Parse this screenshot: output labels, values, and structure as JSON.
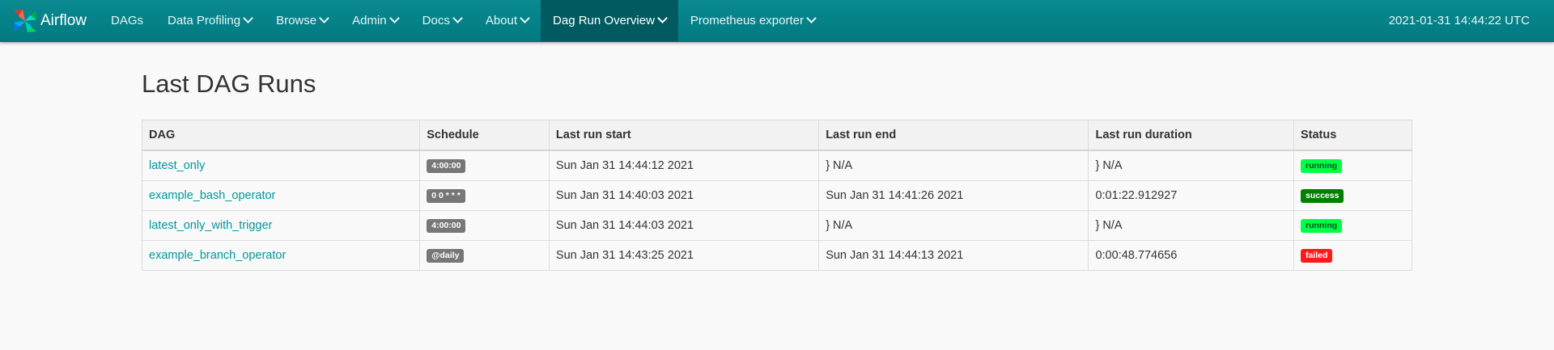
{
  "brand": {
    "name": "Airflow"
  },
  "nav": [
    {
      "label": "DAGs",
      "dropdown": false,
      "active": false
    },
    {
      "label": "Data Profiling",
      "dropdown": true,
      "active": false
    },
    {
      "label": "Browse",
      "dropdown": true,
      "active": false
    },
    {
      "label": "Admin",
      "dropdown": true,
      "active": false
    },
    {
      "label": "Docs",
      "dropdown": true,
      "active": false
    },
    {
      "label": "About",
      "dropdown": true,
      "active": false
    },
    {
      "label": "Dag Run Overview",
      "dropdown": true,
      "active": true
    },
    {
      "label": "Prometheus exporter",
      "dropdown": true,
      "active": false
    }
  ],
  "clock": "2021-01-31 14:44:22 UTC",
  "page": {
    "title": "Last DAG Runs"
  },
  "table": {
    "columns": [
      "DAG",
      "Schedule",
      "Last run start",
      "Last run end",
      "Last run duration",
      "Status"
    ],
    "rows": [
      {
        "dag": "latest_only",
        "schedule": "4:00:00",
        "start": "Sun Jan 31 14:44:12 2021",
        "end": "} N/A",
        "duration": "} N/A",
        "status": "running"
      },
      {
        "dag": "example_bash_operator",
        "schedule": "0 0 * * *",
        "start": "Sun Jan 31 14:40:03 2021",
        "end": "Sun Jan 31 14:41:26 2021",
        "duration": "0:01:22.912927",
        "status": "success"
      },
      {
        "dag": "latest_only_with_trigger",
        "schedule": "4:00:00",
        "start": "Sun Jan 31 14:44:03 2021",
        "end": "} N/A",
        "duration": "} N/A",
        "status": "running"
      },
      {
        "dag": "example_branch_operator",
        "schedule": "@daily",
        "start": "Sun Jan 31 14:43:25 2021",
        "end": "Sun Jan 31 14:44:13 2021",
        "duration": "0:00:48.774656",
        "status": "failed"
      }
    ]
  },
  "colors": {
    "navbar": "#007a80",
    "link": "#00979c",
    "running": "#00ff47",
    "success": "#008000",
    "failed": "#ff1a1a"
  }
}
